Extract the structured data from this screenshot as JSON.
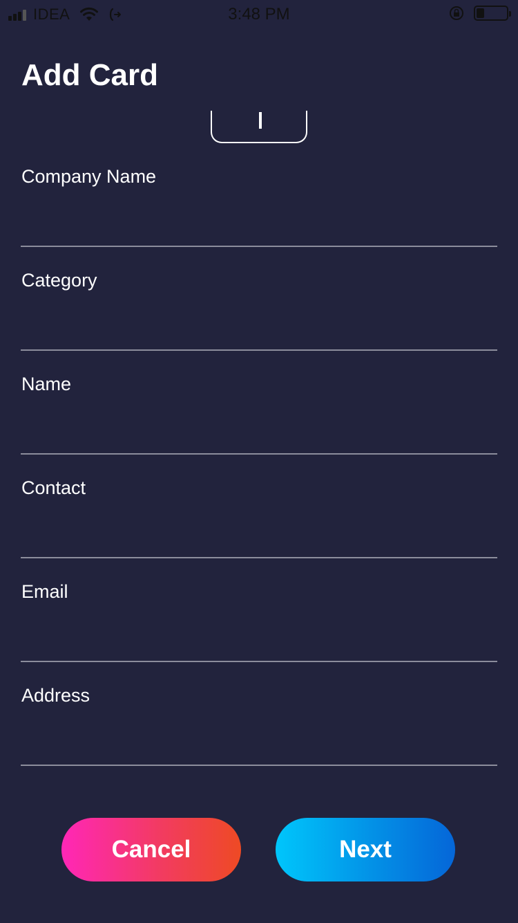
{
  "status_bar": {
    "carrier": "IDEA",
    "time": "3:48 PM",
    "battery_level_percent": 25,
    "icons": [
      "signal-icon",
      "wifi-icon",
      "call-forward-icon",
      "rotation-lock-icon",
      "battery-icon"
    ]
  },
  "header": {
    "title": "Add Card"
  },
  "form": {
    "fields": [
      {
        "label": "Company Name",
        "value": ""
      },
      {
        "label": "Category",
        "value": ""
      },
      {
        "label": "Name",
        "value": ""
      },
      {
        "label": "Contact",
        "value": ""
      },
      {
        "label": "Email",
        "value": ""
      },
      {
        "label": "Address",
        "value": ""
      }
    ]
  },
  "actions": {
    "cancel_label": "Cancel",
    "next_label": "Next"
  },
  "colors": {
    "background": "#22233d",
    "cancel_gradient": [
      "#ff27b7",
      "#ee4a24"
    ],
    "next_gradient": [
      "#00c6fb",
      "#0566d8"
    ]
  }
}
